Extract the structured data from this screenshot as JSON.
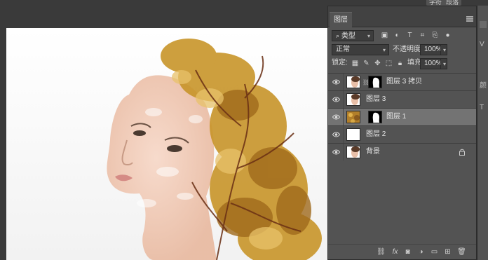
{
  "top_tabs": [
    "字符",
    "段落"
  ],
  "panel": {
    "tab_title": "图层",
    "filter_select": "类型",
    "blend_mode": "正常",
    "opacity_label": "不透明度:",
    "opacity_value": "100%",
    "lock_label": "锁定:",
    "fill_label": "填充:",
    "fill_value": "100%"
  },
  "layers": [
    {
      "name": "图层 3 拷贝",
      "thumb": "portrait",
      "has_mask": true,
      "selected": false,
      "locked": false
    },
    {
      "name": "图层 3",
      "thumb": "portrait",
      "has_mask": false,
      "selected": false,
      "locked": false
    },
    {
      "name": "图层 1",
      "thumb": "leaves",
      "has_mask": true,
      "selected": true,
      "locked": false
    },
    {
      "name": "图层 2",
      "thumb": "white",
      "has_mask": false,
      "selected": false,
      "locked": false
    },
    {
      "name": "背景",
      "thumb": "portrait",
      "has_mask": false,
      "selected": false,
      "locked": true
    }
  ],
  "side_glyphs": [
    "V",
    "颜",
    "T"
  ],
  "icons": {
    "filter": "search-icon",
    "filter_types": [
      "image-filter-icon",
      "adjustment-filter-icon",
      "type-filter-icon",
      "shape-filter-icon",
      "smart-object-filter-icon",
      "filter-toggle-icon"
    ],
    "lock": [
      "lock-transparent-icon",
      "lock-image-icon",
      "lock-position-icon",
      "lock-artboard-icon",
      "lock-all-icon"
    ],
    "bottom": [
      "link-layers-icon",
      "fx-icon",
      "add-mask-icon",
      "adjustment-layer-icon",
      "new-group-icon",
      "new-layer-icon",
      "delete-layer-icon"
    ]
  },
  "colors": {
    "panel_bg": "#535353",
    "selected_row": "#737373",
    "workspace": "#3a3a3a"
  }
}
